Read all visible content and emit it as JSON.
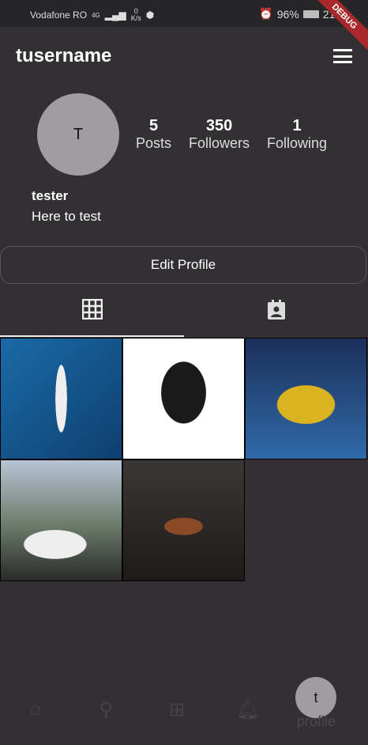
{
  "status": {
    "carrier": "Vodafone RO",
    "network": "4G",
    "speed_value": "0",
    "speed_unit": "K/s",
    "battery": "96%",
    "time": "21:2",
    "debug": "DEBUG"
  },
  "header": {
    "title": "tusername"
  },
  "profile": {
    "avatar_letter": "T",
    "posts": "5",
    "posts_label": "Posts",
    "followers": "350",
    "followers_label": "Followers",
    "following": "1",
    "following_label": "Following",
    "name": "tester",
    "bio": "Here to test",
    "edit_label": "Edit Profile"
  },
  "tabs": [
    {
      "icon": "grid-icon",
      "active": true
    },
    {
      "icon": "contact-tag-icon",
      "active": false
    }
  ],
  "posts": [
    {
      "subject": "yacht"
    },
    {
      "subject": "office chair"
    },
    {
      "subject": "yellow car"
    },
    {
      "subject": "white car"
    },
    {
      "subject": "interior"
    }
  ],
  "nav": {
    "items": [
      "home-icon",
      "search-icon",
      "add-photo-icon",
      "bell-icon"
    ],
    "avatar_letter": "t",
    "profile_label": "profile"
  }
}
